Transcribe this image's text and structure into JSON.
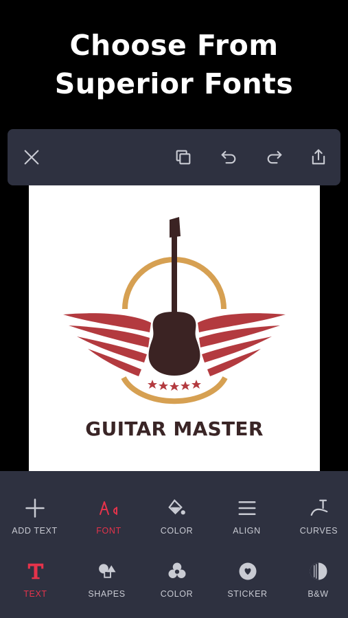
{
  "headline": {
    "line1": "Choose From",
    "line2": "Superior Fonts"
  },
  "toolbar": {
    "icons": [
      "close-icon",
      "duplicate-icon",
      "undo-icon",
      "redo-icon",
      "share-icon"
    ]
  },
  "canvas": {
    "brand_text": "GUITAR MASTER",
    "colors": {
      "wing_red": "#b33a3f",
      "gold": "#d6a052",
      "guitar_brown": "#3b2323"
    }
  },
  "tools_row1": [
    {
      "label": "ADD TEXT",
      "icon": "plus-icon"
    },
    {
      "label": "FONT",
      "icon": "font-icon"
    },
    {
      "label": "COLOR",
      "icon": "paint-bucket-icon"
    },
    {
      "label": "ALIGN",
      "icon": "align-icon"
    },
    {
      "label": "CURVES",
      "icon": "curves-icon"
    }
  ],
  "tools_row2": [
    {
      "label": "TEXT",
      "icon": "text-icon"
    },
    {
      "label": "SHAPES",
      "icon": "shapes-icon"
    },
    {
      "label": "COLOR",
      "icon": "color-circles-icon"
    },
    {
      "label": "STICKER",
      "icon": "sticker-icon"
    },
    {
      "label": "B&W",
      "icon": "bw-icon"
    }
  ],
  "accent_color": "#e5334b",
  "panel_color": "#2e3140"
}
